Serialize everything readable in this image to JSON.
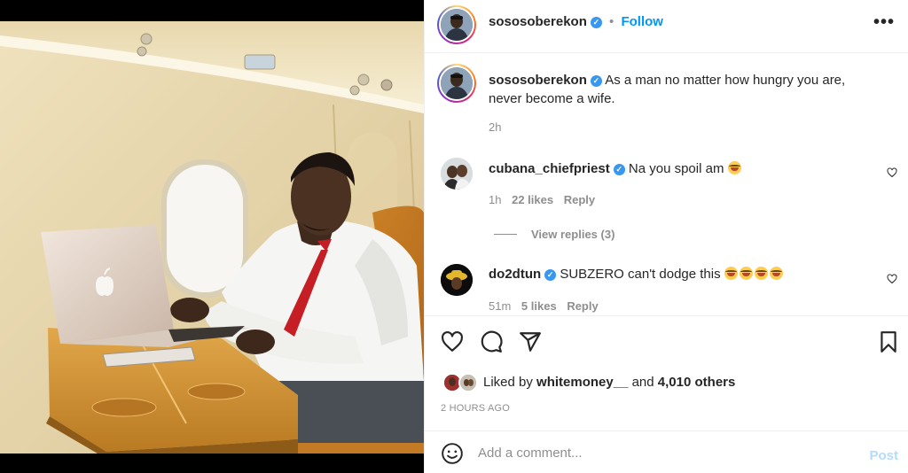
{
  "post": {
    "author": "sososoberekon",
    "follow_label": "Follow",
    "separator": "•",
    "more_icon": "more-horizontal-icon"
  },
  "caption": {
    "username": "sososoberekon",
    "text": "As a man no matter how hungry you are, never become a wife.",
    "time": "2h"
  },
  "comments": [
    {
      "username": "cubana_chiefpriest",
      "text": "Na you spoil am",
      "emoji_count": 1,
      "time": "1h",
      "likes": "22 likes",
      "reply_label": "Reply",
      "view_replies": "View replies (3)"
    },
    {
      "username": "do2dtun",
      "text": "SUBZERO can't dodge this",
      "emoji_count": 4,
      "time": "51m",
      "likes": "5 likes",
      "reply_label": "Reply"
    }
  ],
  "actions": {
    "like_icon": "heart-icon",
    "comment_icon": "comment-icon",
    "share_icon": "paper-plane-icon",
    "save_icon": "bookmark-icon"
  },
  "likes": {
    "prefix": "Liked by",
    "user": "whitemoney__",
    "and": "and",
    "others": "4,010 others"
  },
  "timestamp": "2 HOURS AGO",
  "composer": {
    "placeholder": "Add a comment...",
    "post_label": "Post"
  },
  "colors": {
    "link": "#0095f6",
    "verified": "#3897f0",
    "muted": "#8e8e8e",
    "post_disabled": "#b3dbff"
  }
}
